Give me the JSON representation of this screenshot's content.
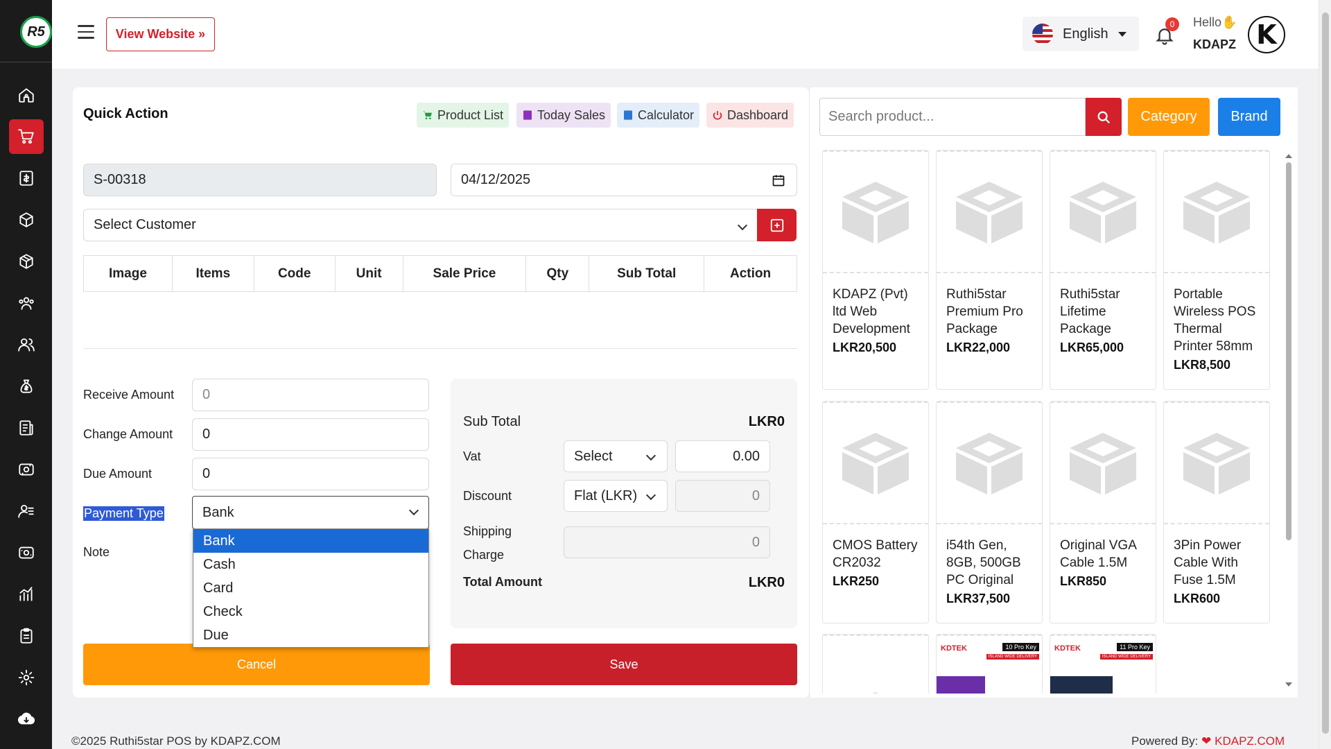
{
  "app": {
    "logo_text": "R5"
  },
  "header": {
    "view_website": "View Website »",
    "language": "English",
    "notif_count": "0",
    "hello": "Hello✋",
    "username": "KDAPZ",
    "avatar_letter": "K"
  },
  "sidebar": {
    "items": [
      {
        "icon": "home-icon"
      },
      {
        "icon": "cart-icon",
        "active": true
      },
      {
        "icon": "receipt-icon"
      },
      {
        "icon": "box-icon"
      },
      {
        "icon": "package-icon"
      },
      {
        "icon": "users-icon"
      },
      {
        "icon": "user-group-icon"
      },
      {
        "icon": "money-bag-icon"
      },
      {
        "icon": "invoice-icon"
      },
      {
        "icon": "cash-icon"
      },
      {
        "icon": "user-list-icon"
      },
      {
        "icon": "cash-register-icon"
      },
      {
        "icon": "chart-icon"
      },
      {
        "icon": "clipboard-icon"
      },
      {
        "icon": "gear-icon"
      },
      {
        "icon": "cloud-download-icon"
      }
    ]
  },
  "quick_action": {
    "title": "Quick Action",
    "buttons": {
      "product_list": "Product List",
      "today_sales": "Today Sales",
      "calculator": "Calculator",
      "dashboard": "Dashboard"
    }
  },
  "sale": {
    "invoice_no": "S-00318",
    "date": "04/12/2025",
    "customer_placeholder": "Select Customer"
  },
  "table": {
    "headers": [
      "Image",
      "Items",
      "Code",
      "Unit",
      "Sale Price",
      "Qty",
      "Sub Total",
      "Action"
    ]
  },
  "payment": {
    "receive_label": "Receive Amount",
    "receive_placeholder": "0",
    "change_label": "Change Amount",
    "change_value": "0",
    "due_label": "Due Amount",
    "due_value": "0",
    "type_label": "Payment Type",
    "type_value": "Bank",
    "note_label": "Note",
    "options": [
      "Bank",
      "Cash",
      "Card",
      "Check",
      "Due"
    ]
  },
  "summary": {
    "sub_total_label": "Sub Total",
    "sub_total_value": "LKR0",
    "vat_label": "Vat",
    "vat_select": "Select",
    "vat_value": "0.00",
    "discount_label": "Discount",
    "discount_type": "Flat (LKR)",
    "discount_value": "0",
    "shipping_label_1": "Shipping",
    "shipping_label_2": "Charge",
    "shipping_value": "0",
    "total_label": "Total Amount",
    "total_value": "LKR0"
  },
  "actions": {
    "cancel": "Cancel",
    "save": "Save"
  },
  "search": {
    "placeholder": "Search product...",
    "category": "Category",
    "brand": "Brand"
  },
  "products": [
    {
      "name": "KDAPZ (Pvt) ltd Web Development",
      "price": "LKR20,500"
    },
    {
      "name": "Ruthi5star Premium Pro Package",
      "price": "LKR22,000"
    },
    {
      "name": "Ruthi5star Lifetime Package",
      "price": "LKR65,000"
    },
    {
      "name": "Portable Wireless POS Thermal Printer 58mm",
      "price": "LKR8,500"
    },
    {
      "name": "CMOS Battery CR2032",
      "price": "LKR250"
    },
    {
      "name": "i54th Gen, 8GB, 500GB PC Original",
      "price": "LKR37,500"
    },
    {
      "name": "Original VGA Cable 1.5M",
      "price": "LKR850"
    },
    {
      "name": "3Pin Power Cable With Fuse 1.5M",
      "price": "LKR600"
    }
  ],
  "partial_products": [
    {
      "brand": "KDTEK",
      "tag": "10 Pro Key",
      "sub": "ISLAND WIDE DELIVERY"
    },
    {
      "brand": "KDTEK",
      "tag": "11 Pro Key",
      "sub": "ISLAND WIDE DELIVERY"
    }
  ],
  "footer": {
    "copyright": "©2025 Ruthi5star POS by KDAPZ.COM",
    "powered_by": "Powered By:",
    "powered_name": "KDAPZ.COM"
  },
  "colors": {
    "primary_red": "#d3202a",
    "orange": "#ff9908",
    "blue": "#1b7fe8",
    "sidebar_bg": "#1b1b1b"
  }
}
